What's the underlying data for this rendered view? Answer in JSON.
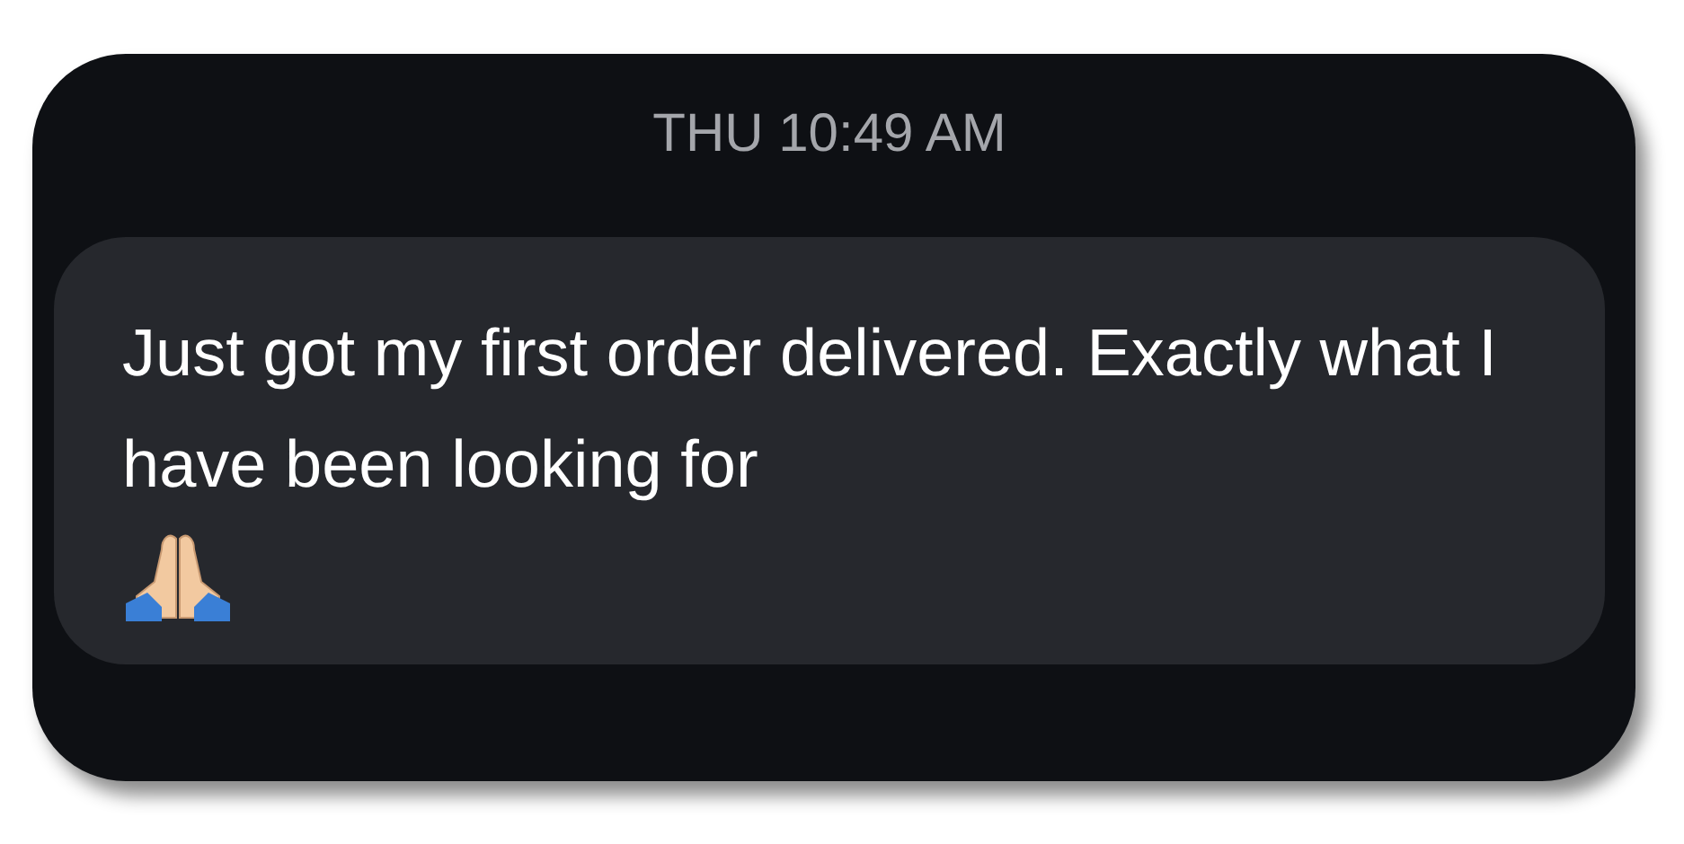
{
  "timestamp": "THU 10:49 AM",
  "message": {
    "text": "Just got my first order delivered. Exactly what I have been looking for"
  }
}
